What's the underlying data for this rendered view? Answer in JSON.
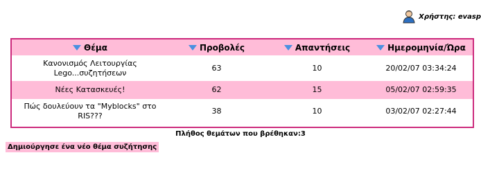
{
  "user": {
    "label": "Χρήστης: evasp",
    "icon": "user-icon"
  },
  "table": {
    "headers": [
      "Θέμα",
      "Προβολές",
      "Απαντήσεις",
      "Ημερομηνία/Ώρα"
    ],
    "sort_icon": "sort-arrow-down-icon",
    "rows": [
      {
        "topic": "Κανονισμός Λειτουργίας Lego...συζητήσεων",
        "views": "63",
        "replies": "10",
        "datetime": "20/02/07 03:34:24"
      },
      {
        "topic": "Νέες Κατασκευές!",
        "views": "62",
        "replies": "15",
        "datetime": "05/02/07 02:59:35"
      },
      {
        "topic": "Πώς δουλεύουν τα \"Myblocks\" στο RIS???",
        "views": "38",
        "replies": "10",
        "datetime": "03/02/07 02:27:44"
      }
    ]
  },
  "count_text": "Πλήθος θεμάτων που βρέθηκαν:3",
  "create_label": "Δημιούργησε ένα νέο θέμα συζήτησης",
  "colors": {
    "accent": "#cc2a7c",
    "row_pink": "#ffbcd8",
    "arrow": "#4a90e0"
  }
}
